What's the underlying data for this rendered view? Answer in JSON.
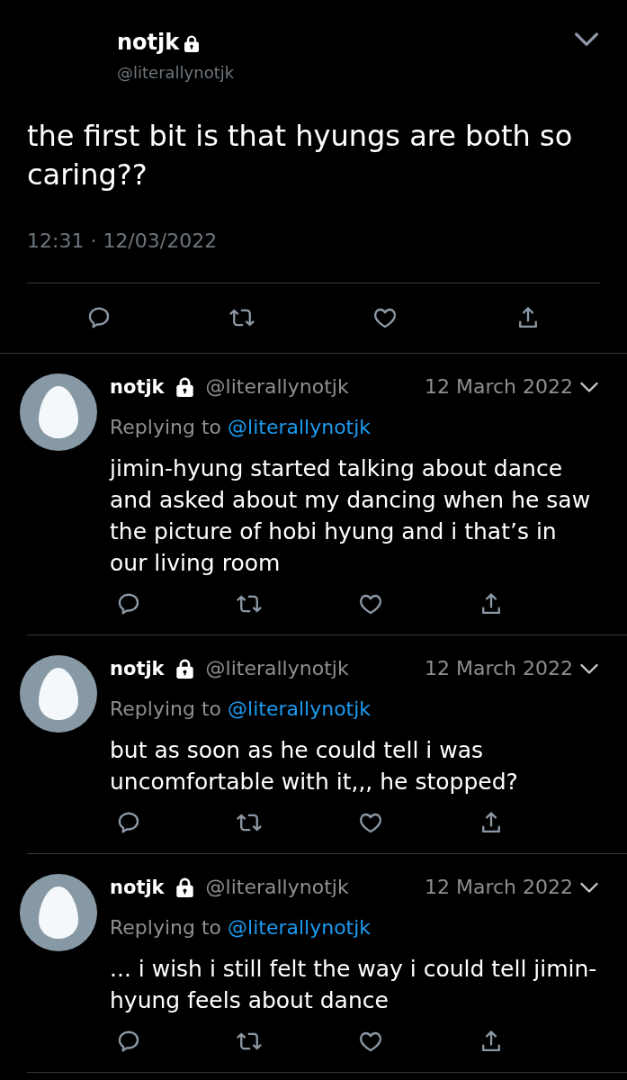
{
  "main_tweet": {
    "name": "notjk",
    "protected": true,
    "handle": "@literallynotjk",
    "text": "the first bit is that hyungs are both so caring??",
    "timestamp": "12:31 · 12/03/2022"
  },
  "replies": [
    {
      "name": "notjk",
      "protected": true,
      "handle": "@literallynotjk",
      "date": "12 March 2022",
      "replying_label": "Replying to",
      "replying_handle": "@literallynotjk",
      "text": "jimin-hyung started talking about dance and asked about my dancing when he saw the picture of hobi hyung and i that’s in our living room"
    },
    {
      "name": "notjk",
      "protected": true,
      "handle": "@literallynotjk",
      "date": "12 March 2022",
      "replying_label": "Replying to",
      "replying_handle": "@literallynotjk",
      "text": "but as soon as he could tell i was uncomfortable with it,,, he stopped?"
    },
    {
      "name": "notjk",
      "protected": true,
      "handle": "@literallynotjk",
      "date": "12 March 2022",
      "replying_label": "Replying to",
      "replying_handle": "@literallynotjk",
      "text": "... i wish i still felt the way i could tell jimin-hyung feels about dance"
    }
  ]
}
